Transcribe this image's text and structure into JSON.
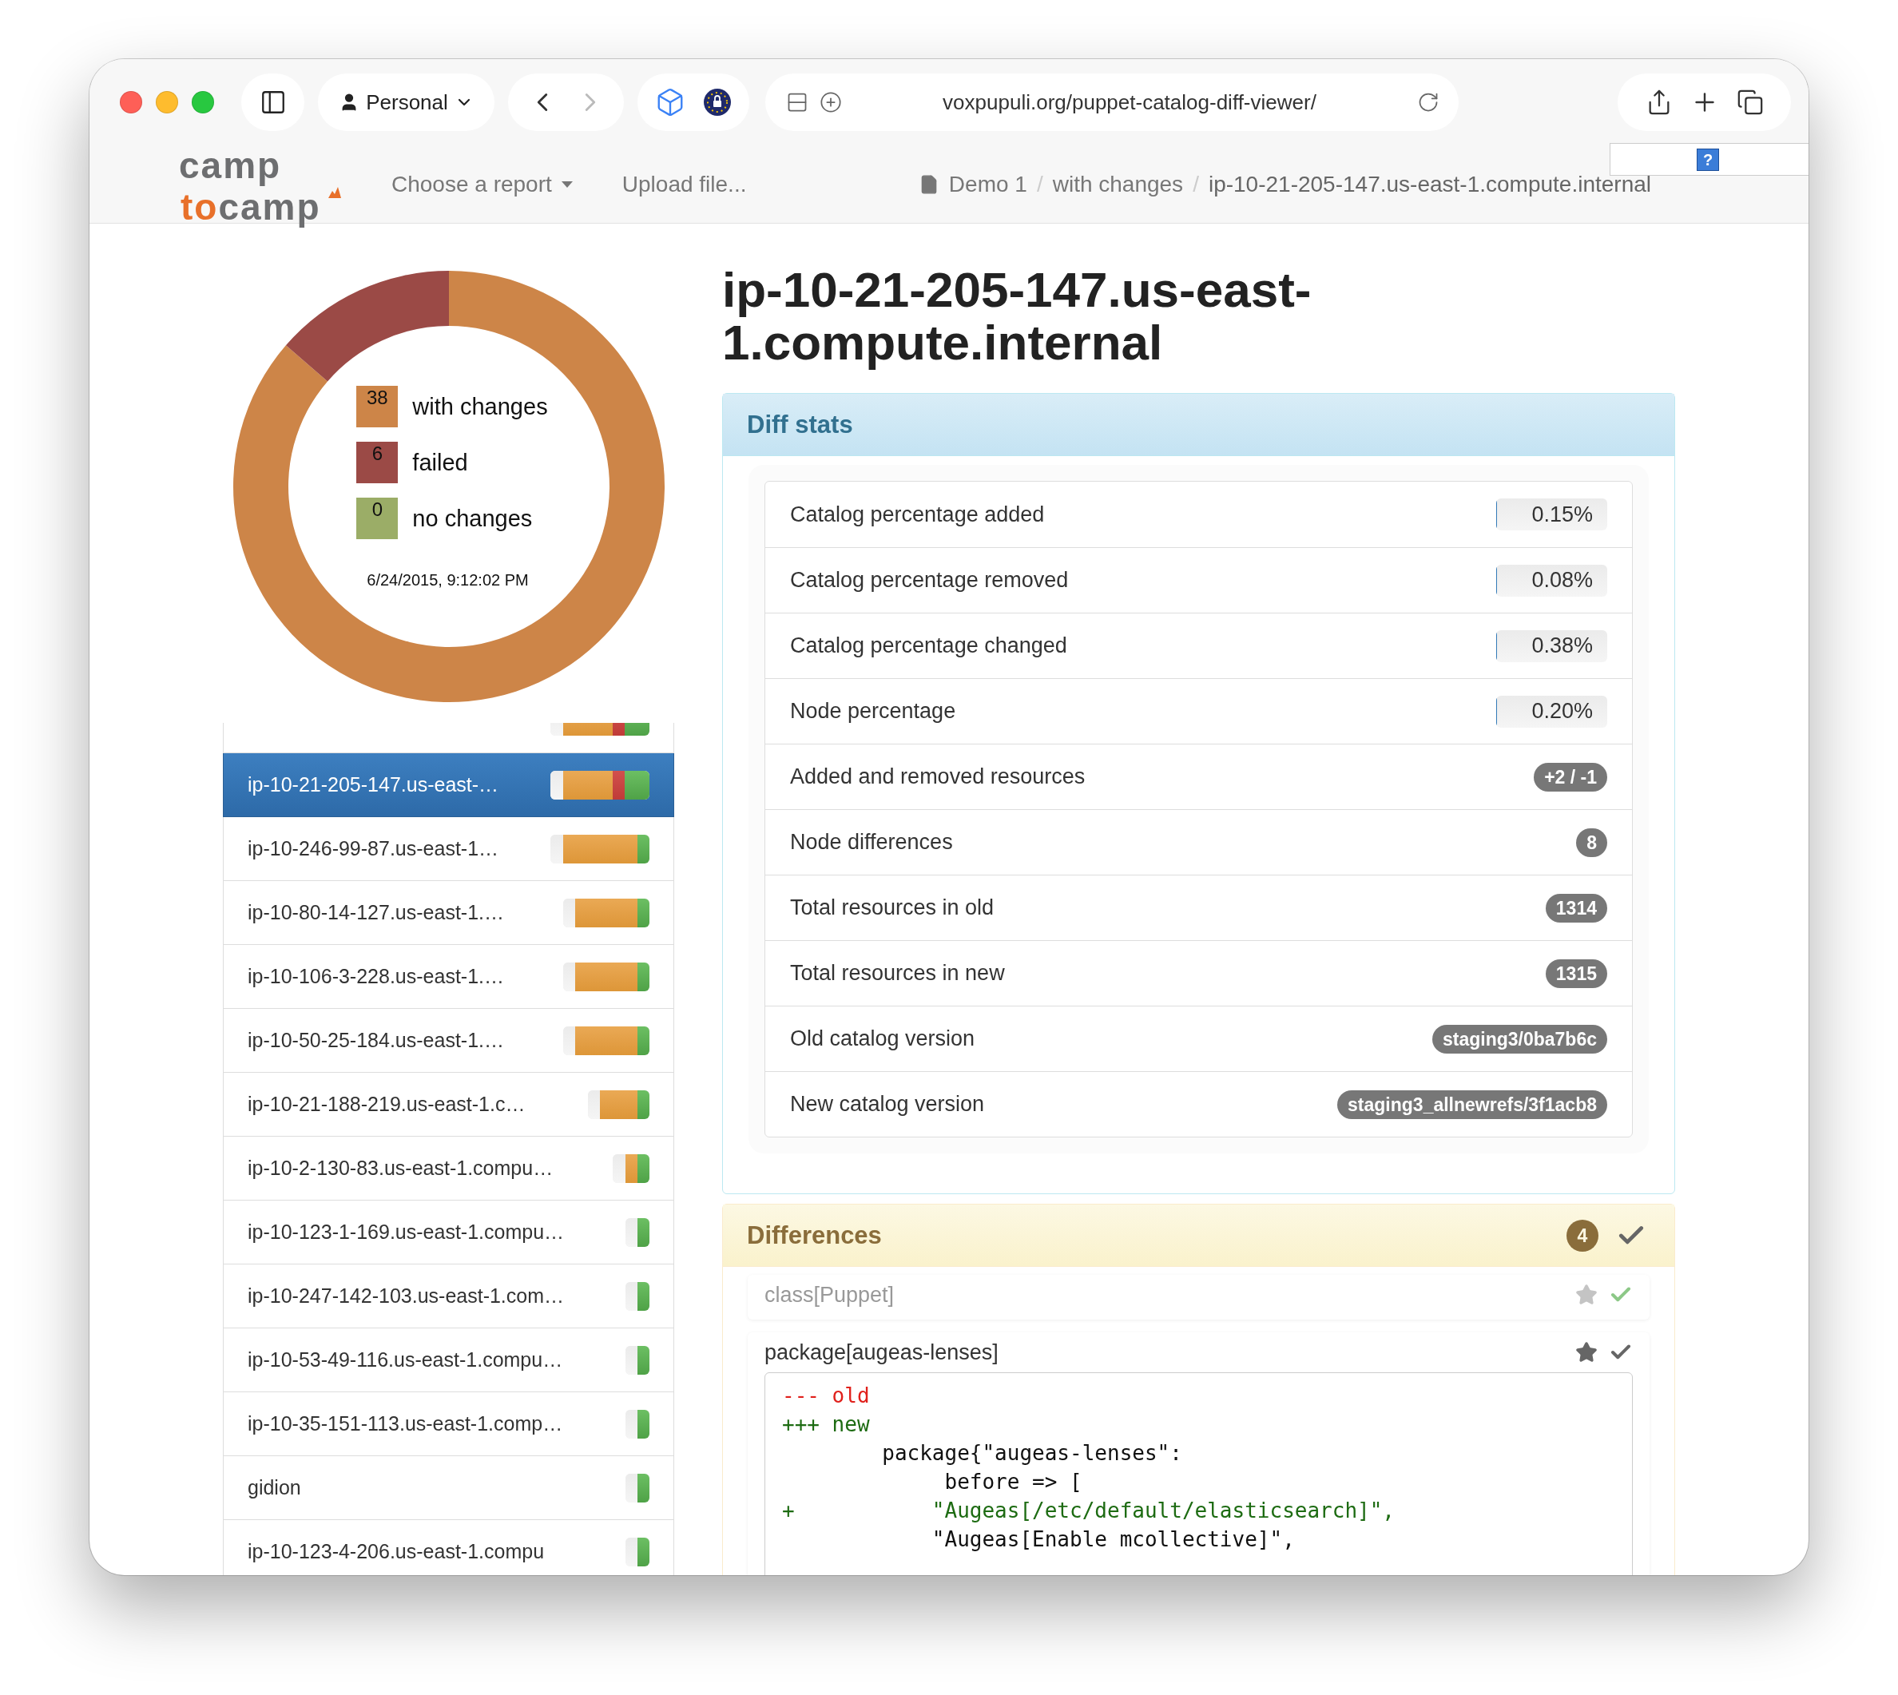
{
  "browser": {
    "profile": "Personal",
    "url": "voxpupuli.org/puppet-catalog-diff-viewer/",
    "back_disabled": false,
    "forward_disabled": true
  },
  "help_button": "?",
  "navbar": {
    "logo": {
      "top": "camp",
      "accent": "to",
      "rest": "camp"
    },
    "menu": [
      {
        "kind": "dropdown",
        "label": "Choose a report"
      },
      {
        "kind": "link",
        "label": "Upload file..."
      }
    ],
    "breadcrumb": [
      {
        "kind": "item",
        "text": "Demo 1"
      },
      {
        "kind": "separator",
        "text": "/"
      },
      {
        "kind": "item",
        "text": "with changes"
      },
      {
        "kind": "separator",
        "text": "/"
      },
      {
        "kind": "current",
        "text": "ip-10-21-205-147.us-east-1.compute.internal"
      }
    ]
  },
  "summary": {
    "chart_data": {
      "type": "donut",
      "categories": [
        "with changes",
        "failed",
        "no changes"
      ],
      "values": [
        86.36,
        13.64,
        0
      ]
    },
    "legend": [
      {
        "count": "38",
        "color": "#cd8548"
      },
      {
        "count": "6",
        "color": "#9b4a46"
      },
      {
        "count": "0",
        "color": "#9bad67"
      }
    ],
    "timestamp": "6/24/2015, 9:12:02 PM"
  },
  "nodes": [
    {
      "selected": false,
      "kind": "mixed"
    },
    {
      "name": "ip-10-21-205-147.us-east-…",
      "selected": true,
      "kind": "mixed"
    },
    {
      "name": "ip-10-246-99-87.us-east-1…",
      "selected": false,
      "kind": "changed"
    },
    {
      "name": "ip-10-80-14-127.us-east-1.…",
      "selected": false,
      "kind": "long"
    },
    {
      "name": "ip-10-106-3-228.us-east-1.…",
      "selected": false,
      "kind": "long"
    },
    {
      "name": "ip-10-50-25-184.us-east-1.…",
      "selected": false,
      "kind": "long"
    },
    {
      "name": "ip-10-21-188-219.us-east-1.c…",
      "selected": false,
      "kind": "medium"
    },
    {
      "name": "ip-10-2-130-83.us-east-1.compu…",
      "selected": false,
      "kind": "short"
    },
    {
      "name": "ip-10-123-1-169.us-east-1.compu…",
      "selected": false,
      "kind": "unchanged"
    },
    {
      "name": "ip-10-247-142-103.us-east-1.com…",
      "selected": false,
      "kind": "unchanged"
    },
    {
      "name": "ip-10-53-49-116.us-east-1.compu…",
      "selected": false,
      "kind": "unchanged"
    },
    {
      "name": "ip-10-35-151-113.us-east-1.comp…",
      "selected": false,
      "kind": "unchanged"
    },
    {
      "name": "gidion",
      "selected": false,
      "kind": "unchanged"
    },
    {
      "name": "ip-10-123-4-206.us-east-1.compu",
      "selected": false,
      "kind": "unchanged"
    }
  ],
  "title": "ip-10-21-205-147.us-east-1.compute.internal",
  "diff_stats": {
    "title": "Diff stats",
    "rows": [
      {
        "kind": "progress",
        "label": "Catalog percentage added",
        "value": "0.15%",
        "level": 0.0015
      },
      {
        "kind": "progress",
        "label": "Catalog percentage removed",
        "value": "0.08%",
        "level": 0.0008
      },
      {
        "kind": "progress",
        "label": "Catalog percentage changed",
        "value": "0.38%",
        "level": 0.0038
      },
      {
        "kind": "progress",
        "label": "Node percentage",
        "value": "0.20%",
        "level": 0.002
      },
      {
        "kind": "badge",
        "label": "Added and removed resources",
        "value": "+2 / -1"
      },
      {
        "kind": "badge",
        "label": "Node differences",
        "value": "8"
      },
      {
        "kind": "badge",
        "label": "Total resources in old",
        "value": "1314"
      },
      {
        "kind": "badge",
        "label": "Total resources in new",
        "value": "1315"
      },
      {
        "kind": "badge",
        "label": "Old catalog version",
        "value": "staging3/0ba7b6c"
      },
      {
        "kind": "badge",
        "label": "New catalog version",
        "value": "staging3_allnewrefs/3f1acb8"
      }
    ]
  },
  "differences": {
    "title": "Differences",
    "count": "4",
    "items": [
      {
        "name": "class[Puppet]",
        "done": true
      },
      {
        "name": "package[augeas-lenses]",
        "done": false,
        "diff": [
          {
            "kind": "removed_header",
            "text": "--- old"
          },
          {
            "kind": "added_header",
            "text": "+++ new"
          },
          {
            "kind": "context",
            "text": "        package{\"augeas-lenses\":"
          },
          {
            "kind": "context",
            "text": "             before => ["
          },
          {
            "kind": "added",
            "text": "+           \"Augeas[/etc/default/elasticsearch]\","
          },
          {
            "kind": "context",
            "text": "            \"Augeas[Enable mcollective]\","
          }
        ]
      }
    ]
  }
}
